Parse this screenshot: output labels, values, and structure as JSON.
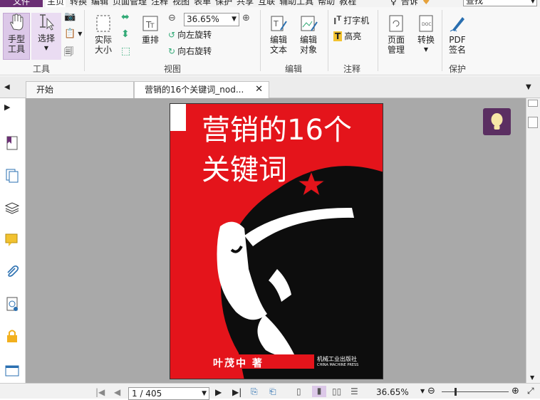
{
  "menu": {
    "file": "文件",
    "items": [
      "主页",
      "转换",
      "编辑",
      "页面管理",
      "注释",
      "视图",
      "表单",
      "保护",
      "共享",
      "互联",
      "辅助工具",
      "帮助",
      "教程"
    ],
    "right": [
      "告诉"
    ],
    "search_placeholder": "查找"
  },
  "ribbon": {
    "hand": "手型\n工具",
    "select": "选择",
    "tools_group": "工具",
    "actual_size": "实际\n大小",
    "reflow": "重排",
    "zoom_value": "36.65%",
    "rotate_left": "向左旋转",
    "rotate_right": "向右旋转",
    "view_group": "视图",
    "edit_text": "编辑\n文本",
    "edit_object": "编辑\n对象",
    "edit_group": "编辑",
    "typewriter": "打字机",
    "highlight": "高亮",
    "comment_group": "注释",
    "page_mgmt": "页面\n管理",
    "convert": "转换",
    "pdf_sign": "PDF\n签名",
    "protect_group": "保护"
  },
  "tabs": [
    {
      "label": "开始"
    },
    {
      "label": "营销的16个关键词_nod..."
    }
  ],
  "document": {
    "cover_title_line1": "营销的16个",
    "cover_title_line2": "关键词",
    "author": "叶茂中 著",
    "publisher": "机械工业出版社",
    "publisher_en": "CHINA MACHINE PRESS"
  },
  "status": {
    "page": "1 / 405",
    "zoom": "36.65%"
  },
  "colors": {
    "accent": "#6b2f74",
    "cover_red": "#e4141b",
    "canvas": "#a9a9a9"
  }
}
